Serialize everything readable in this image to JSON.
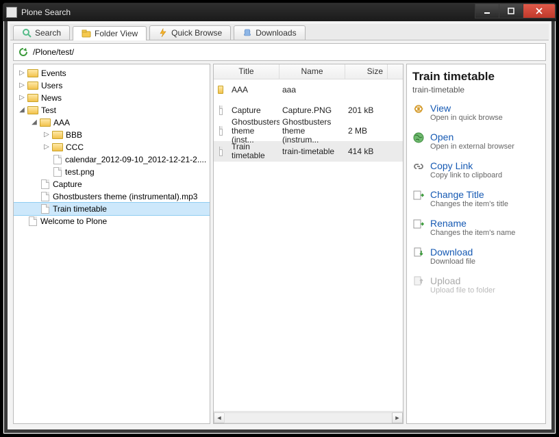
{
  "window": {
    "title": "Plone Search"
  },
  "tabs": [
    {
      "id": "search",
      "label": "Search"
    },
    {
      "id": "folder-view",
      "label": "Folder View",
      "active": true
    },
    {
      "id": "quick-browse",
      "label": "Quick Browse"
    },
    {
      "id": "downloads",
      "label": "Downloads"
    }
  ],
  "path": "/Plone/test/",
  "tree": [
    {
      "label": "Events",
      "type": "folder",
      "depth": 0,
      "exp": "closed"
    },
    {
      "label": "Users",
      "type": "folder",
      "depth": 0,
      "exp": "closed"
    },
    {
      "label": "News",
      "type": "folder",
      "depth": 0,
      "exp": "closed"
    },
    {
      "label": "Test",
      "type": "folder",
      "depth": 0,
      "exp": "open"
    },
    {
      "label": "AAA",
      "type": "folder",
      "depth": 1,
      "exp": "open"
    },
    {
      "label": "BBB",
      "type": "folder",
      "depth": 2,
      "exp": "closed"
    },
    {
      "label": "CCC",
      "type": "folder",
      "depth": 2,
      "exp": "closed"
    },
    {
      "label": "calendar_2012-09-10_2012-12-21-2....",
      "type": "file",
      "depth": 2
    },
    {
      "label": "test.png",
      "type": "file",
      "depth": 2
    },
    {
      "label": "Capture",
      "type": "file",
      "depth": 1
    },
    {
      "label": "Ghostbusters theme (instrumental).mp3",
      "type": "file",
      "depth": 1
    },
    {
      "label": "Train timetable",
      "type": "file",
      "depth": 1,
      "selected": true
    },
    {
      "label": "Welcome to Plone",
      "type": "file",
      "depth": 0
    }
  ],
  "list": {
    "columns": {
      "title": "Title",
      "name": "Name",
      "size": "Size"
    },
    "rows": [
      {
        "icon": "folder",
        "title": "AAA",
        "name": "aaa",
        "size": ""
      },
      {
        "icon": "file",
        "title": "Capture",
        "name": "Capture.PNG",
        "size": "201 kB"
      },
      {
        "icon": "file",
        "title": "Ghostbusters theme (inst...",
        "name": "Ghostbusters theme (instrum...",
        "size": "2 MB"
      },
      {
        "icon": "file",
        "title": "Train timetable",
        "name": "train-timetable",
        "size": "414 kB",
        "selected": true
      }
    ]
  },
  "detail": {
    "title": "Train timetable",
    "subtitle": "train-timetable",
    "actions": [
      {
        "id": "view",
        "title": "View",
        "desc": "Open in quick browse",
        "icon": "eye"
      },
      {
        "id": "open",
        "title": "Open",
        "desc": "Open in external browser",
        "icon": "globe"
      },
      {
        "id": "copy-link",
        "title": "Copy Link",
        "desc": "Copy link to clipboard",
        "icon": "link"
      },
      {
        "id": "change-title",
        "title": "Change Title",
        "desc": "Changes the item's title",
        "icon": "rename"
      },
      {
        "id": "rename",
        "title": "Rename",
        "desc": "Changes the item's name",
        "icon": "rename"
      },
      {
        "id": "download",
        "title": "Download",
        "desc": "Download file",
        "icon": "download"
      },
      {
        "id": "upload",
        "title": "Upload",
        "desc": "Upload file to folder",
        "icon": "upload",
        "disabled": true
      }
    ]
  }
}
